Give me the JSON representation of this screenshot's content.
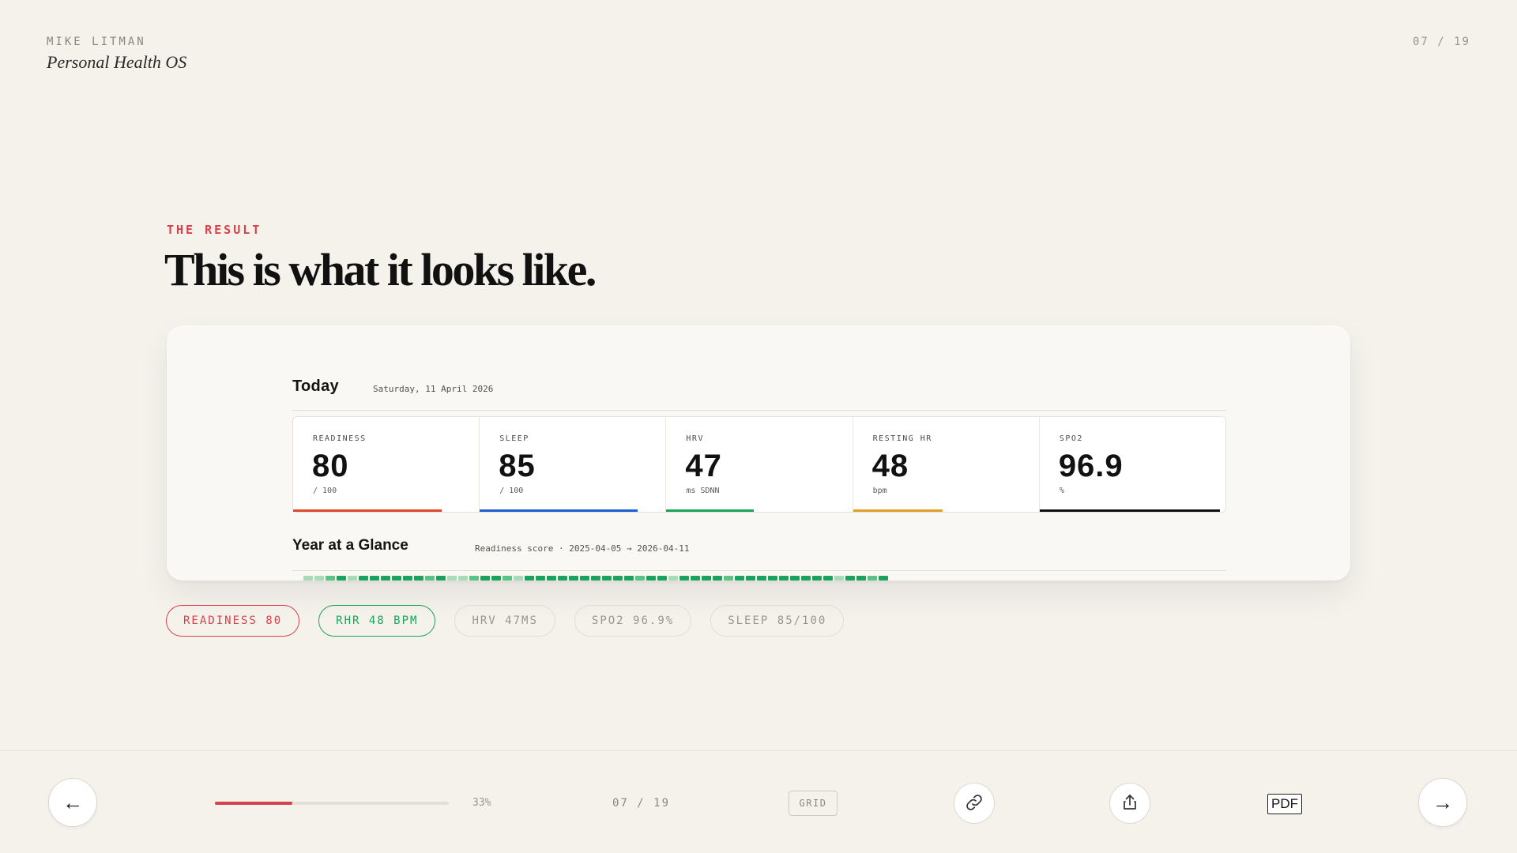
{
  "header": {
    "author": "MIKE LITMAN",
    "title": "Personal Health OS",
    "page_counter": "07 / 19"
  },
  "section": {
    "eyebrow": "THE RESULT",
    "headline": "This is what it looks like."
  },
  "preview": {
    "today_title": "Today",
    "today_date": "Saturday, 11 April 2026",
    "metrics": [
      {
        "label": "READINESS",
        "value": "80",
        "unit": "/ 100",
        "color": "#e2462b",
        "bar_fraction": 0.8
      },
      {
        "label": "SLEEP",
        "value": "85",
        "unit": "/ 100",
        "color": "#1f5fd6",
        "bar_fraction": 0.85
      },
      {
        "label": "HRV",
        "value": "47",
        "unit": "ms SDNN",
        "color": "#1aa35a",
        "bar_fraction": 0.47
      },
      {
        "label": "RESTING HR",
        "value": "48",
        "unit": "bpm",
        "color": "#e0a12a",
        "bar_fraction": 0.48
      },
      {
        "label": "SPO2",
        "value": "96.9",
        "unit": "%",
        "color": "#111111",
        "bar_fraction": 0.969
      }
    ],
    "year_title": "Year at a Glance",
    "year_subtitle": "Readiness score · 2025-04-05 → 2026-04-11",
    "heatmap_levels": [
      1,
      1,
      2,
      3,
      1,
      3,
      3,
      3,
      3,
      3,
      3,
      2,
      3,
      1,
      1,
      2,
      3,
      3,
      2,
      1,
      3,
      3,
      3,
      3,
      3,
      3,
      3,
      3,
      3,
      3,
      2,
      3,
      3,
      1,
      3,
      3,
      3,
      3,
      2,
      3,
      3,
      3,
      3,
      3,
      3,
      3,
      3,
      3,
      1,
      3,
      3,
      2,
      3
    ],
    "heatmap_colors": [
      "#eaf6ee",
      "#a8dcb9",
      "#5cc483",
      "#1aa35a"
    ]
  },
  "pills": [
    {
      "label": "READINESS 80",
      "style": "red"
    },
    {
      "label": "RHR 48 BPM",
      "style": "green"
    },
    {
      "label": "HRV 47MS",
      "style": "muted"
    },
    {
      "label": "SPO2 96.9%",
      "style": "muted"
    },
    {
      "label": "SLEEP 85/100",
      "style": "muted"
    }
  ],
  "footer": {
    "progress_fraction": 0.33,
    "progress_label": "33%",
    "page_counter": "07 / 19",
    "grid_label": "GRID",
    "pdf_label": "PDF",
    "prev_icon": "←",
    "next_icon": "→"
  },
  "colors": {
    "accent": "#d6424c",
    "success": "#1aa35a",
    "background": "#f5f2ec"
  }
}
